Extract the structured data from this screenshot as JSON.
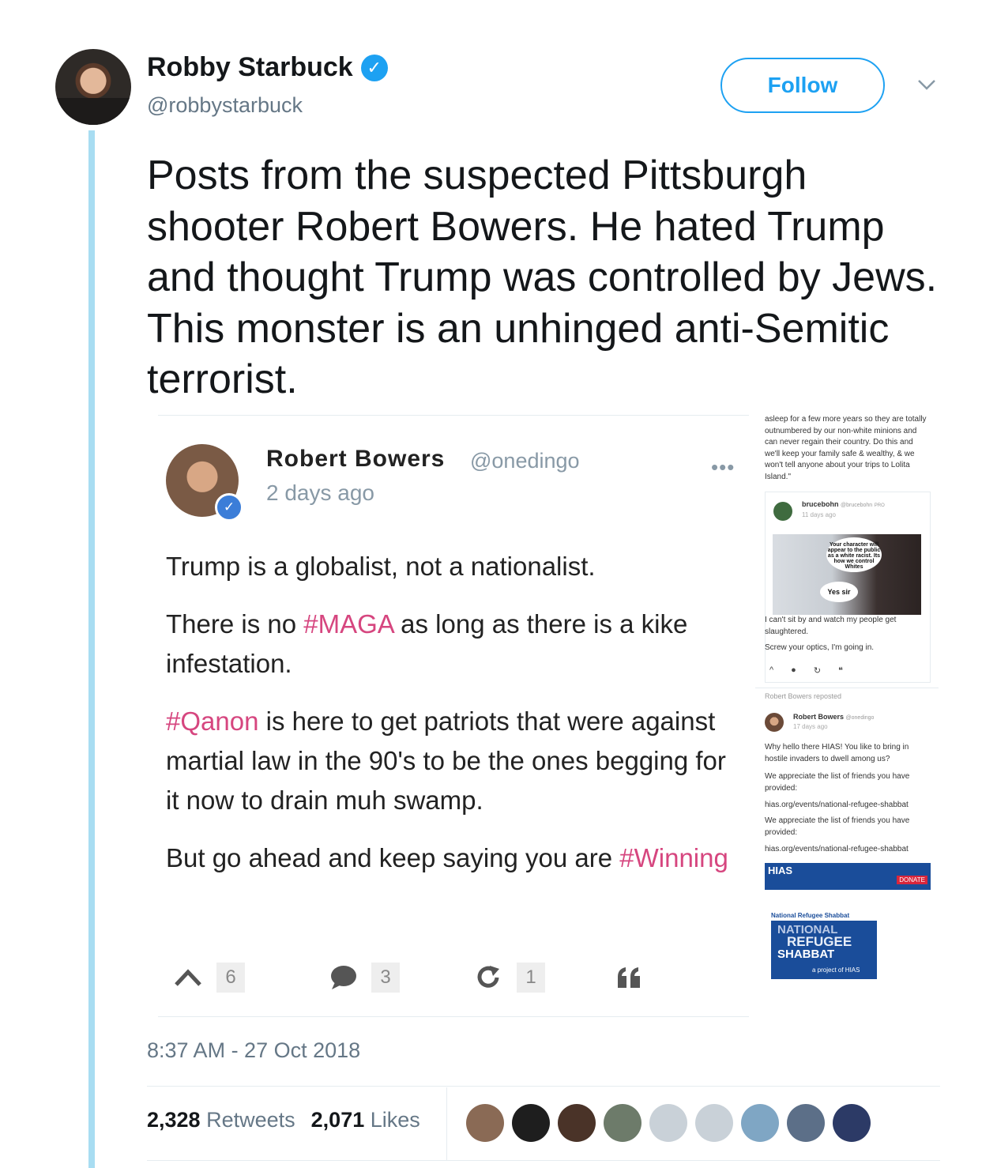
{
  "author": {
    "name": "Robby Starbuck",
    "handle": "@robbystarbuck",
    "verified_mark": "✓"
  },
  "follow_label": "Follow",
  "tweet_text": "Posts from the suspected Pittsburgh shooter Robert Bowers. He hated Trump and thought Trump was controlled by Jews. This monster is an unhinged anti-Semitic terrorist.",
  "embedded_post": {
    "name": "Robert Bowers",
    "handle": "@onedingo",
    "time": "2 days ago",
    "dots": "•••",
    "check": "✓",
    "p1": "Trump is a globalist, not a nationalist.",
    "p2_before": "There is no ",
    "p2_tag": "#MAGA",
    "p2_after": " as long as there is a kike infestation.",
    "p3_tag": "#Qanon",
    "p3_after": " is here to get patriots that were against martial law in the 90's to be the ones begging for it now to drain muh swamp.",
    "p4_before": "But go ahead and keep saying you are ",
    "p4_tag": "#Winning",
    "counts": {
      "up": "6",
      "comments": "3",
      "reposts": "1"
    }
  },
  "side_screenshot": {
    "top_text": "asleep for a few more years so they are totally outnumbered by our non-white minions and can never regain their country. Do this and we'll keep your family safe & wealthy, & we won't tell anyone about your trips to Lolita Island.\"",
    "inner_name": "brucebohn",
    "inner_handle": "@brucebohn",
    "inner_badge": "PRO",
    "inner_time": "11 days ago",
    "bubble1": "Your character will appear to the public as a white racist. Its how we control Whites",
    "bubble2": "Yes sir",
    "text2": "I can't sit by and watch my people get slaughtered.",
    "text3": "Screw your optics, I'm going in.",
    "repost_label": "Robert Bowers reposted",
    "rp_name": "Robert Bowers",
    "rp_handle": "@onedingo",
    "rp_time": "17 days ago",
    "rp_text1": "Why hello there HIAS! You like to bring in hostile invaders to dwell among us?",
    "rp_text2": "We appreciate the list of friends you have provided:",
    "rp_link1": "hias.org/events/national-refugee-shabbat",
    "rp_text3": "We appreciate the list of friends you have provided:",
    "rp_link2": "hias.org/events/national-refugee-shabbat",
    "hias_logo": "HIAS",
    "donate": "DONATE",
    "nrs_title": "National Refugee Shabbat",
    "nrs_line1": "NATIONAL",
    "nrs_line2": "REFUGEE",
    "nrs_line3": "SHABBAT",
    "nrs_sub": "a project of HIAS"
  },
  "timestamp": "8:37 AM - 27 Oct 2018",
  "retweets": {
    "count": "2,328",
    "label": "Retweets"
  },
  "likes": {
    "count": "2,071",
    "label": "Likes"
  },
  "liker_colors": [
    "#8a6a55",
    "#1e1e1e",
    "#4a3328",
    "#6d7b6a",
    "#c9d1d8",
    "#c9d1d8",
    "#7fa6c4",
    "#5c6f88",
    "#2c3a66"
  ],
  "colors": {
    "accent": "#1da1f2",
    "thread": "#a8ddf2",
    "hashtag": "#d6467f"
  }
}
